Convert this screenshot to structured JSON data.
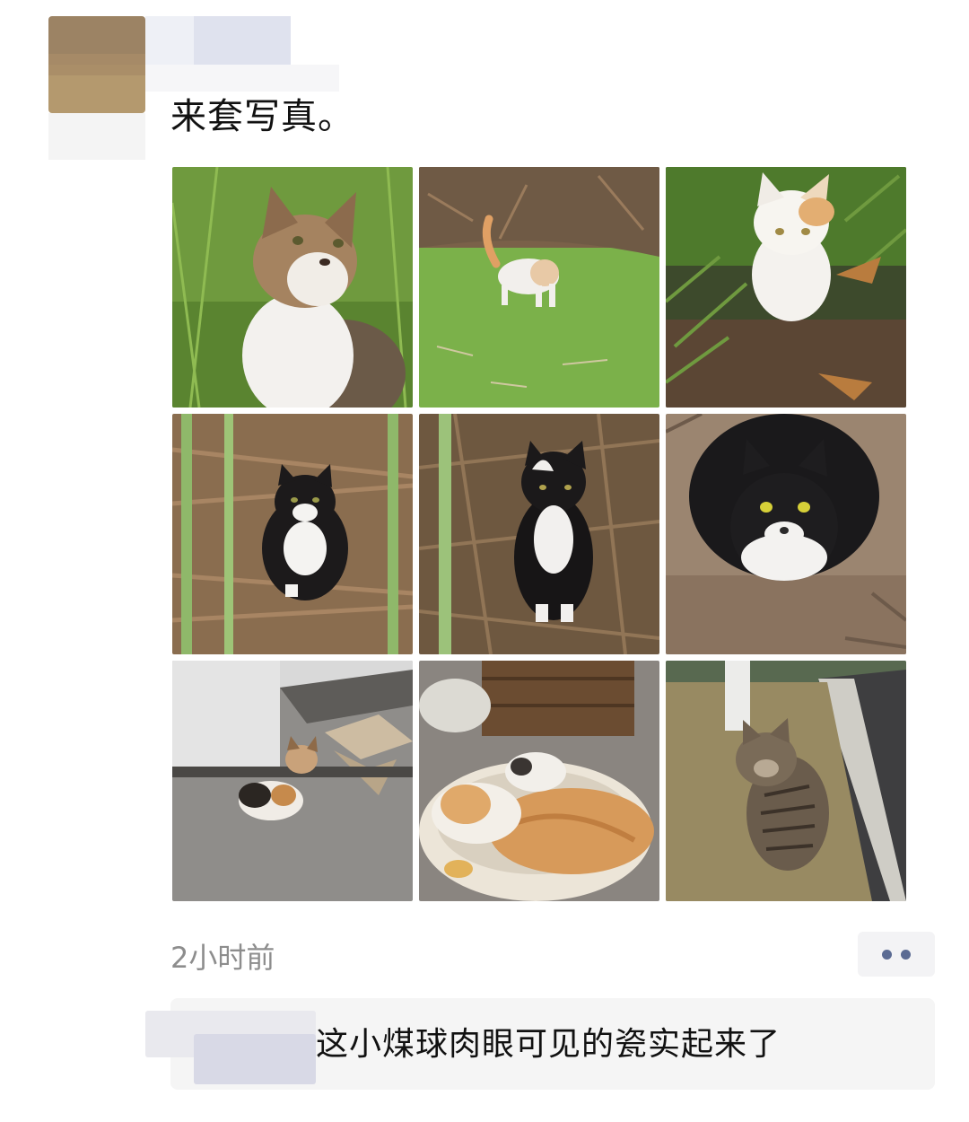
{
  "post": {
    "text": "来套写真。",
    "time": "2小时前",
    "photos": [
      {
        "name": "photo-calico-cat-on-grass"
      },
      {
        "name": "photo-white-cat-walking-on-moss"
      },
      {
        "name": "photo-white-orange-cat-in-plants"
      },
      {
        "name": "photo-tuxedo-cat-in-bamboo"
      },
      {
        "name": "photo-tuxedo-cat-standing"
      },
      {
        "name": "photo-tuxedo-cat-closeup"
      },
      {
        "name": "photo-calico-cat-on-pavement"
      },
      {
        "name": "photo-cats-sleeping-in-bed"
      },
      {
        "name": "photo-tabby-cat-by-road"
      }
    ]
  },
  "comment": {
    "text": "这小煤球肉眼可见的瓷实起来了"
  },
  "icons": {
    "more": "more-dots-icon"
  },
  "colors": {
    "accent_dots": "#5b6b93",
    "time_text": "#8d8d8d",
    "comment_bg": "#f5f5f5"
  }
}
